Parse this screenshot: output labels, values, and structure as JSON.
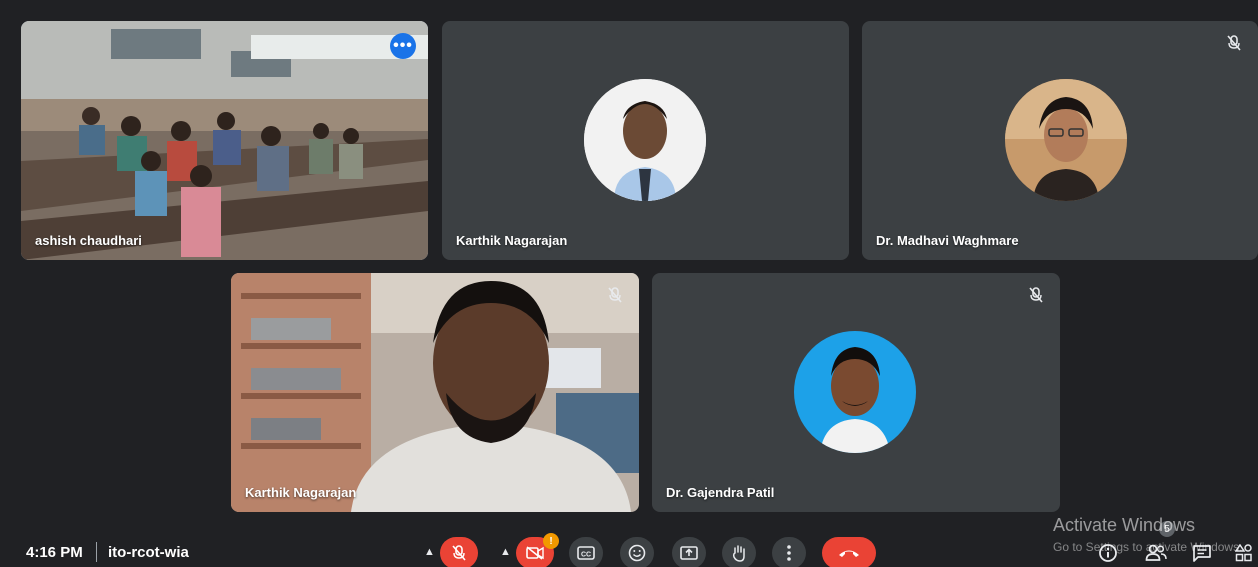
{
  "tiles": [
    {
      "name": "ashish chaudhari"
    },
    {
      "name": "Karthik Nagarajan"
    },
    {
      "name": "Dr. Madhavi Waghmare"
    },
    {
      "name": "Karthik Nagarajan"
    },
    {
      "name": "Dr. Gajendra Patil"
    }
  ],
  "more_options": "•••",
  "bottom_bar": {
    "time": "4:16 PM",
    "meeting_code": "ito-rcot-wia",
    "camera_alert_badge": "!",
    "people_count": "5"
  },
  "watermark": {
    "line1": "Activate Windows",
    "line2": "Go to Settings to activate Windows."
  },
  "colors": {
    "background": "#202124",
    "tile": "#3c4043",
    "danger": "#ea4335",
    "active_speaker": "#8ab4f8",
    "accent_blue": "#1a73e8"
  }
}
